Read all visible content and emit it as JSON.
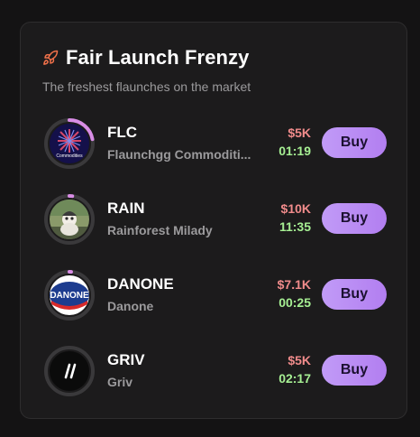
{
  "header": {
    "icon": "rocket-icon",
    "title": "Fair Launch Frenzy",
    "subtitle": "The freshest flaunches on the market"
  },
  "colors": {
    "mcap": "#f08b8b",
    "timer": "#a6ef93",
    "buy_gradient_start": "#c19bf7",
    "buy_gradient_end": "#b27ef0",
    "ring_progress": "#d98de6",
    "ring_track": "#3a393b"
  },
  "tokens": [
    {
      "symbol": "FLC",
      "name": "Flaunchgg Commoditi...",
      "mcap": "$5K",
      "timer": "01:19",
      "buy_label": "Buy",
      "progress": 0.22,
      "avatar": "flc-logo"
    },
    {
      "symbol": "RAIN",
      "name": "Rainforest Milady",
      "mcap": "$10K",
      "timer": "11:35",
      "buy_label": "Buy",
      "progress": 0.02,
      "avatar": "milady-image"
    },
    {
      "symbol": "DANONE",
      "name": "Danone",
      "mcap": "$7.1K",
      "timer": "00:25",
      "buy_label": "Buy",
      "progress": 0.01,
      "avatar": "danone-logo"
    },
    {
      "symbol": "GRIV",
      "name": "Griv",
      "mcap": "$5K",
      "timer": "02:17",
      "buy_label": "Buy",
      "progress": 0.0,
      "avatar": "griv-logo"
    }
  ]
}
